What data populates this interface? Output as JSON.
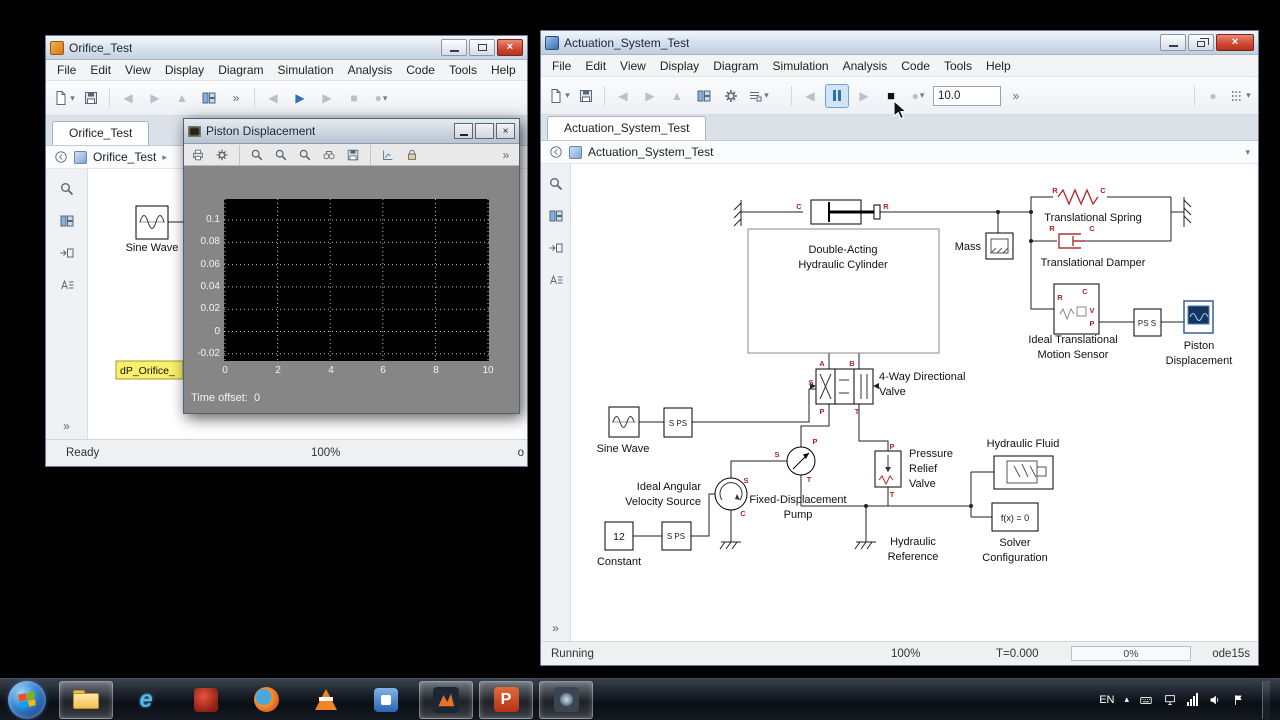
{
  "glyphs": {
    "dropdown": "▾",
    "overflow": "»",
    "crumb_arrow": "▸",
    "close": "×",
    "back": "◀",
    "forward": "▶",
    "up": "▲",
    "play": "▶",
    "step": "▶",
    "stop": "■",
    "record": "●",
    "rewind": "◀",
    "tray_chevron": "▴"
  },
  "shared": {
    "menu": [
      "File",
      "Edit",
      "View",
      "Display",
      "Diagram",
      "Simulation",
      "Analysis",
      "Code",
      "Tools",
      "Help"
    ]
  },
  "orifice": {
    "title": "Orifice_Test",
    "tab": "Orifice_Test",
    "breadcrumb": "Orifice_Test",
    "canvas": {
      "sine_wave": "Sine Wave",
      "highlight_block": "dP_Orifice_"
    },
    "status": {
      "state": "Ready",
      "zoom": "100%",
      "right": "o"
    }
  },
  "scope": {
    "title": "Piston Displacement",
    "time_offset_label": "Time offset:",
    "time_offset_value": "0",
    "y_ticks": [
      "0.1",
      "0.08",
      "0.06",
      "0.04",
      "0.02",
      "0",
      "-0.02"
    ],
    "x_ticks": [
      "0",
      "2",
      "4",
      "6",
      "8",
      "10"
    ]
  },
  "actuation": {
    "title": "Actuation_System_Test",
    "tab": "Actuation_System_Test",
    "breadcrumb": "Actuation_System_Test",
    "toolbar": {
      "stop_time": "10.0"
    },
    "status": {
      "state": "Running",
      "zoom": "100%",
      "time": "T=0.000",
      "progress": "0%",
      "solver": "ode15s"
    }
  },
  "diagram": {
    "labels": {
      "cyl1": "Double-Acting",
      "cyl2": "Hydraulic Cylinder",
      "mass": "Mass",
      "spring": "Translational Spring",
      "damper": "Translational Damper",
      "sensor1": "Ideal Translational",
      "sensor2": "Motion Sensor",
      "scope1": "Piston",
      "scope2": "Displacement",
      "valve1": "4-Way Directional",
      "valve2": "Valve",
      "sine": "Sine Wave",
      "sps": "S PS",
      "pss": "PS S",
      "pump1": "Fixed-Displacement",
      "pump2": "Pump",
      "relief1": "Pressure",
      "relief2": "Relief",
      "relief3": "Valve",
      "fluid": "Hydraulic Fluid",
      "source1": "Ideal Angular",
      "source2": "Velocity Source",
      "ref1": "Hydraulic",
      "ref2": "Reference",
      "const_value": "12",
      "const": "Constant",
      "solver_expr": "f(x) = 0",
      "solver1": "Solver",
      "solver2": "Configuration"
    },
    "ports": {
      "A": "A",
      "B": "B",
      "P": "P",
      "T": "T",
      "S": "S",
      "C": "C",
      "R": "R",
      "V": "V"
    }
  },
  "chart_data": {
    "type": "line",
    "title": "Piston Displacement scope (empty axes, simulation at T=0.000)",
    "x": [],
    "series": [],
    "xlim": [
      0,
      10
    ],
    "ylim": [
      -0.02,
      0.1
    ],
    "x_ticks": [
      0,
      2,
      4,
      6,
      8,
      10
    ],
    "y_ticks": [
      0.1,
      0.08,
      0.06,
      0.04,
      0.02,
      0,
      -0.02
    ],
    "grid": true,
    "legend": false
  },
  "taskbar": {
    "tray_lang": "EN",
    "ie_letter": "e",
    "ppt_letter": "P"
  }
}
